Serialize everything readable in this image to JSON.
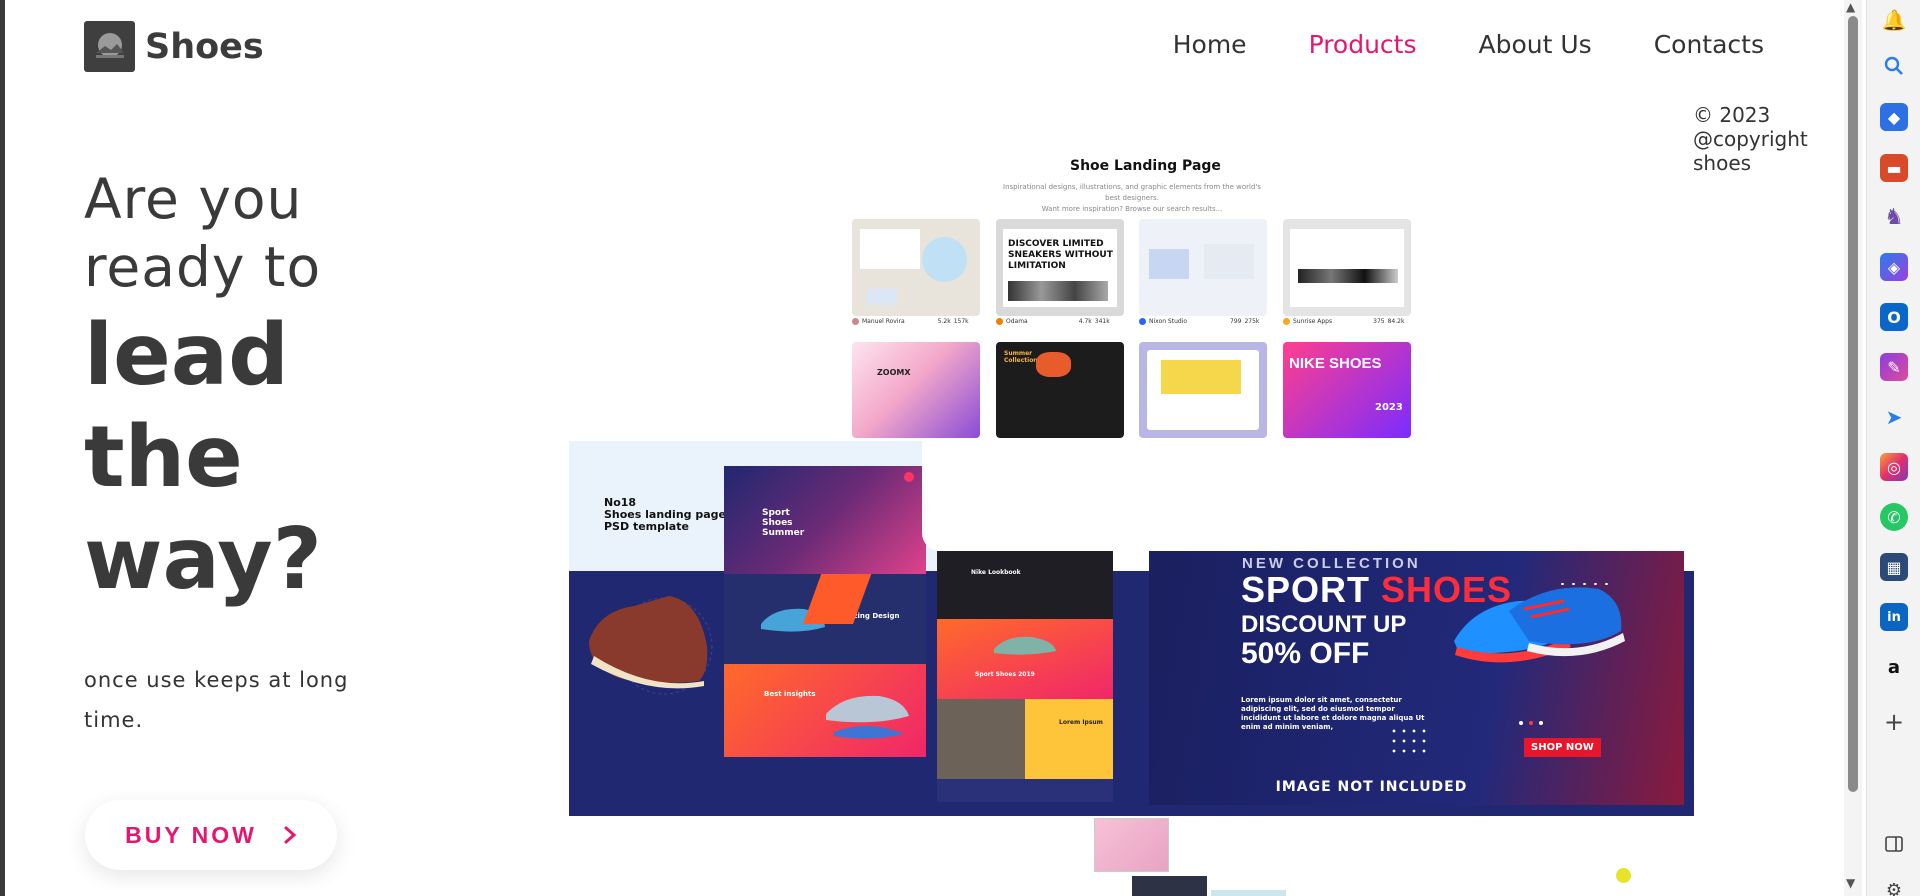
{
  "brand": {
    "name": "Shoes"
  },
  "nav": {
    "items": [
      "Home",
      "Products",
      "About Us",
      "Contacts"
    ],
    "active": "Products"
  },
  "copyright": {
    "line1": "© 2023",
    "line2": "@copyright",
    "line3": "shoes"
  },
  "hero": {
    "line1": "Are you",
    "line2": "ready to",
    "line3": "lead",
    "line4": "the",
    "line5": "way?",
    "subtitle": "once use keeps at long time.",
    "cta": "BUY NOW"
  },
  "gallery": {
    "title": "Shoe Landing Page",
    "desc_line1": "Inspirational designs, illustrations, and graphic elements from the world's best designers.",
    "desc_line2": "Want more inspiration? Browse our search results...",
    "shots": [
      {
        "author": "Manuel Rovira",
        "likes": "5.2k",
        "views": "157k",
        "text": ""
      },
      {
        "author": "Odama",
        "likes": "4.7k",
        "views": "341k",
        "text": "DISCOVER LIMITED SNEAKERS WITHOUT LIMITATION"
      },
      {
        "author": "Nixon Studio",
        "likes": "799",
        "views": "275k",
        "text": ""
      },
      {
        "author": "Sunrise Apps",
        "likes": "375",
        "views": "84.2k",
        "text": ""
      },
      {
        "author": "",
        "likes": "",
        "views": "",
        "text": "ZOOMX"
      },
      {
        "author": "",
        "likes": "",
        "views": "",
        "text": "Summer Collection"
      },
      {
        "author": "",
        "likes": "",
        "views": "",
        "text": ""
      },
      {
        "author": "",
        "likes": "",
        "views": "",
        "text": "NIKE SHOES"
      }
    ],
    "nike_year": "2023"
  },
  "banner": {
    "psd_line1": "No18",
    "psd_line2": "Shoes landing page",
    "psd_line3": "PSD template",
    "panel1_title": "Sport Shoes Summer",
    "panel2_title": "Amazing Design",
    "panel3_title": "Best insights",
    "panel4_title": "Nike Lookbook",
    "panel5_title": "Sport Shoes 2019",
    "panel6_title": "Lorem Ipsum",
    "collection": "NEW COLLECTION",
    "sport_word": "SPORT",
    "shoes_word": "SHOES",
    "discount": "DISCOUNT UP",
    "off": "50% OFF",
    "lorem": "Lorem ipsum dolor sit amet, consectetur adipiscing elit, sed do eiusmod tempor incididunt ut labore et dolore magna aliqua Ut enim ad minim veniam,",
    "shop_now": "SHOP NOW",
    "note": "IMAGE NOT INCLUDED"
  },
  "colors": {
    "accent": "#e6166f",
    "text": "#333333",
    "navy": "#1f2870",
    "red": "#e8162a"
  },
  "sidebar_icons": [
    "bell-icon",
    "search-icon",
    "tag-icon",
    "briefcase-icon",
    "chess-icon",
    "copilot-icon",
    "outlook-icon",
    "designer-icon",
    "send-icon",
    "instagram-icon",
    "whatsapp-icon",
    "calendar-app-icon",
    "linkedin-icon",
    "amazon-icon",
    "plus-icon",
    "panel-icon",
    "settings-icon"
  ]
}
